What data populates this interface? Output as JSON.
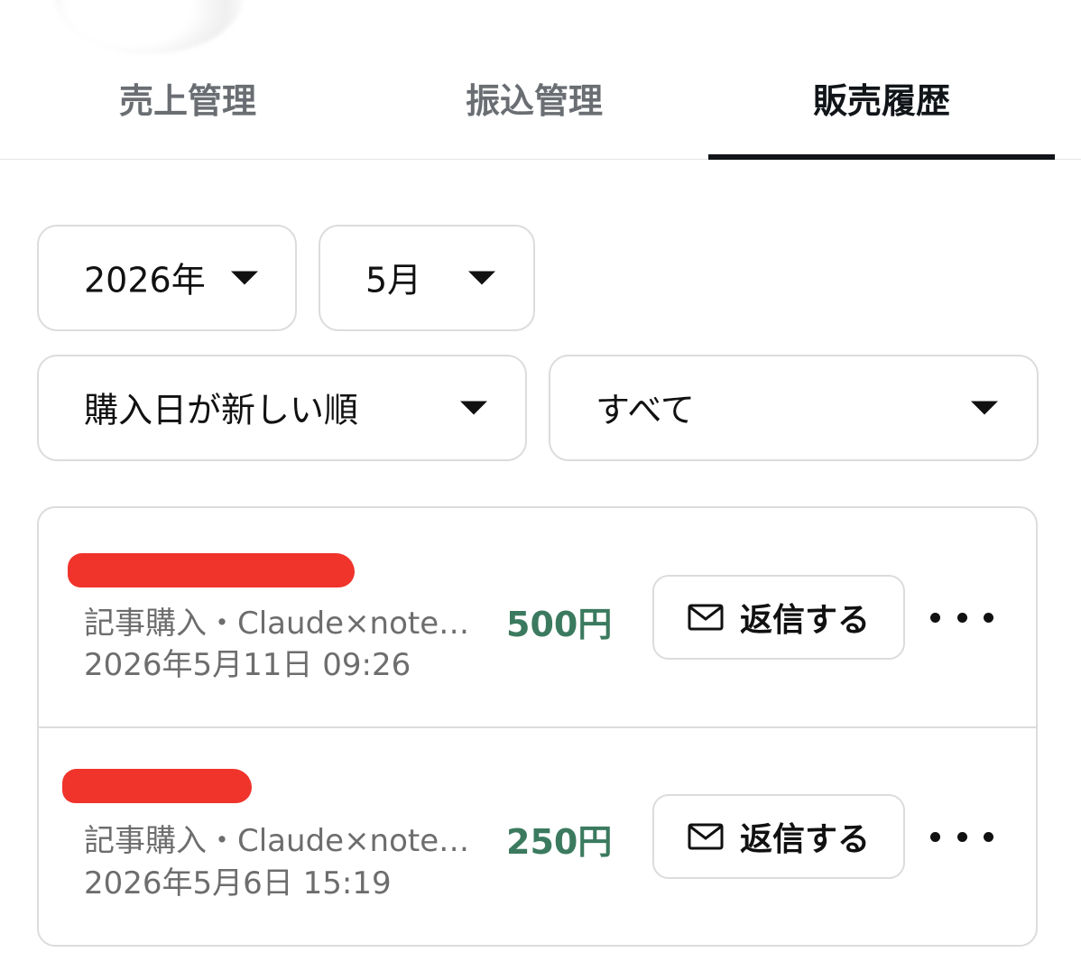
{
  "tabs": [
    {
      "label": "売上管理",
      "active": false
    },
    {
      "label": "振込管理",
      "active": false
    },
    {
      "label": "販売履歴",
      "active": true
    }
  ],
  "filters": {
    "year": "2026年",
    "month": "5月",
    "sort": "購入日が新しい順",
    "category": "すべて"
  },
  "sales": [
    {
      "type_title": "記事購入・Claude×note…",
      "datetime": "2026年5月11日 09:26",
      "price": "500円",
      "reply_label": "返信する"
    },
    {
      "type_title": "記事購入・Claude×note…",
      "datetime": "2026年5月6日 15:19",
      "price": "250円",
      "reply_label": "返信する"
    }
  ],
  "colors": {
    "price": "#3b7a5f",
    "active_tab_indicator": "#111418",
    "redaction": "#f0342c",
    "border": "#dcdcdc"
  }
}
